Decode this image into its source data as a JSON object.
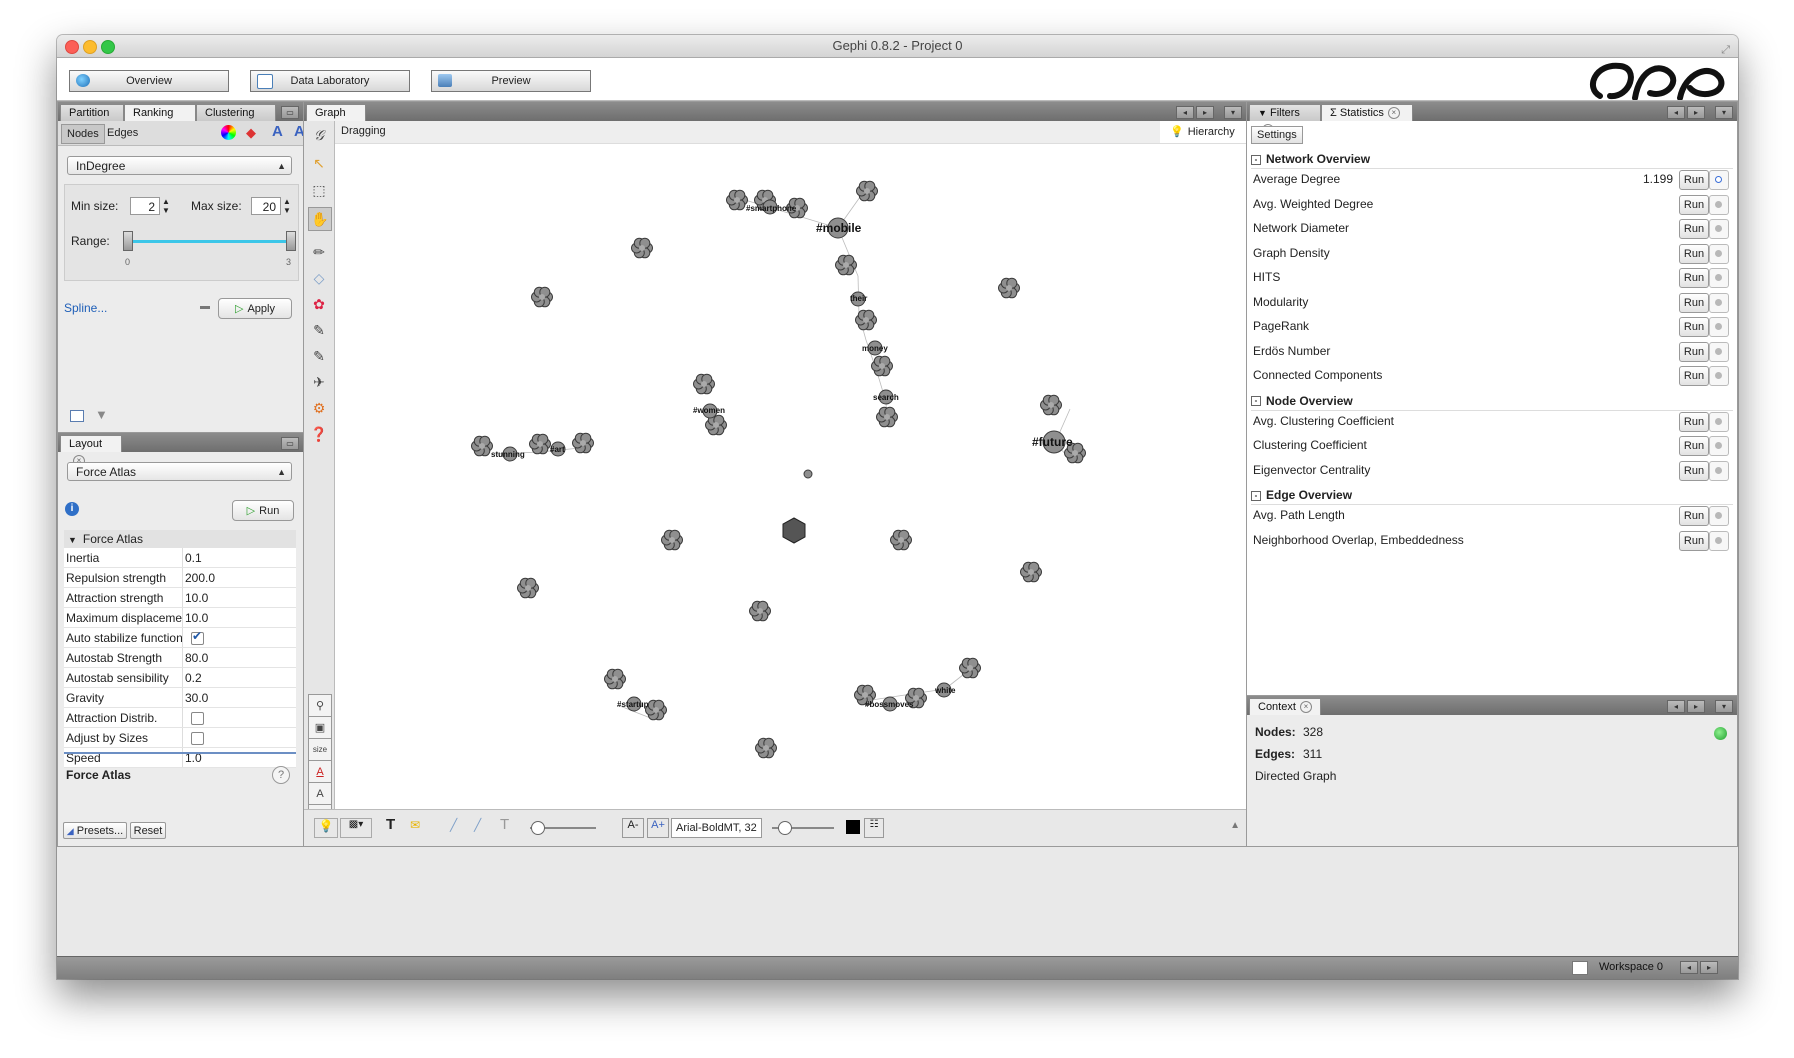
{
  "window": {
    "title": "Gephi 0.8.2 - Project 0"
  },
  "toolbar": {
    "tabs": [
      {
        "label": "Overview",
        "icon": "globe-icon"
      },
      {
        "label": "Data Laboratory",
        "icon": "table-icon"
      },
      {
        "label": "Preview",
        "icon": "monitor-icon"
      }
    ]
  },
  "ranking_panel": {
    "tabs": [
      "Partition",
      "Ranking",
      "Clustering"
    ],
    "subtabs": [
      "Nodes",
      "Edges"
    ],
    "attribute": "InDegree",
    "min_size_label": "Min size:",
    "min_size": "2",
    "max_size_label": "Max size:",
    "max_size": "20",
    "range_label": "Range:",
    "range_min": "0",
    "range_max": "3",
    "spline_label": "Spline...",
    "apply_label": "Apply"
  },
  "layout_panel": {
    "tab": "Layout",
    "algorithm": "Force Atlas",
    "run_label": "Run",
    "group_label": "Force Atlas",
    "properties": [
      {
        "name": "Inertia",
        "value": "0.1"
      },
      {
        "name": "Repulsion strength",
        "value": "200.0"
      },
      {
        "name": "Attraction strength",
        "value": "10.0"
      },
      {
        "name": "Maximum displacement",
        "value": "10.0"
      },
      {
        "name": "Auto stabilize function",
        "value": "",
        "checked": true
      },
      {
        "name": "Autostab Strength",
        "value": "80.0"
      },
      {
        "name": "Autostab sensibility",
        "value": "0.2"
      },
      {
        "name": "Gravity",
        "value": "30.0"
      },
      {
        "name": "Attraction Distrib.",
        "value": "",
        "checked": false
      },
      {
        "name": "Adjust by Sizes",
        "value": "",
        "checked": false
      },
      {
        "name": "Speed",
        "value": "1.0"
      }
    ],
    "description_title": "Force Atlas",
    "presets_label": "Presets...",
    "reset_label": "Reset"
  },
  "graph_panel": {
    "tab": "Graph",
    "mode": "Dragging",
    "hierarchy_label": "Hierarchy",
    "labels": [
      "#smartphone",
      "#mobile",
      "their",
      "money",
      "search",
      "#women",
      "stunning",
      "#art",
      "#future",
      "#startup",
      "#bossmoves",
      "white"
    ],
    "font_label": "Arial-BoldMT, 32",
    "size_label": "size"
  },
  "statistics_panel": {
    "tabs": [
      "Filters",
      "Statistics"
    ],
    "settings_label": "Settings",
    "sections": [
      {
        "title": "Network Overview",
        "rows": [
          {
            "name": "Average Degree",
            "value": "1.199"
          },
          {
            "name": "Avg. Weighted Degree",
            "value": ""
          },
          {
            "name": "Network Diameter",
            "value": ""
          },
          {
            "name": "Graph Density",
            "value": ""
          },
          {
            "name": "HITS",
            "value": ""
          },
          {
            "name": "Modularity",
            "value": ""
          },
          {
            "name": "PageRank",
            "value": ""
          },
          {
            "name": "Erdös Number",
            "value": ""
          },
          {
            "name": "Connected Components",
            "value": ""
          }
        ]
      },
      {
        "title": "Node Overview",
        "rows": [
          {
            "name": "Avg. Clustering Coefficient",
            "value": ""
          },
          {
            "name": "Clustering Coefficient",
            "value": ""
          },
          {
            "name": "Eigenvector Centrality",
            "value": ""
          }
        ]
      },
      {
        "title": "Edge Overview",
        "rows": [
          {
            "name": "Avg. Path Length",
            "value": ""
          },
          {
            "name": "Neighborhood Overlap, Embeddedness",
            "value": ""
          }
        ]
      }
    ],
    "run_label": "Run"
  },
  "context_panel": {
    "tab": "Context",
    "nodes_label": "Nodes:",
    "nodes": "328",
    "edges_label": "Edges:",
    "edges": "311",
    "graph_type": "Directed Graph"
  },
  "statusbar": {
    "workspace": "Workspace 0"
  }
}
